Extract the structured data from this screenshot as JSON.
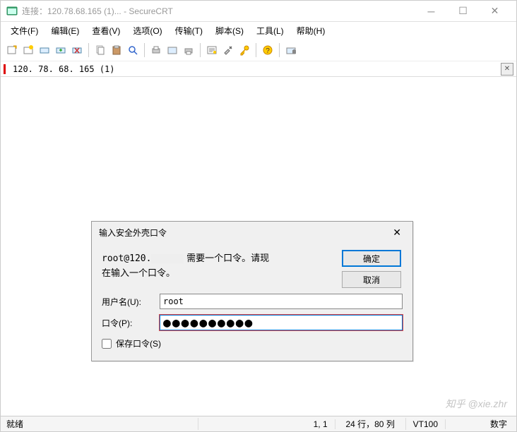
{
  "titlebar": {
    "text": "连接：120.78.68.165 (1)... - SecureCRT"
  },
  "menu": {
    "file": "文件(F)",
    "edit": "编辑(E)",
    "view": "查看(V)",
    "options": "选项(O)",
    "transfer": "传输(T)",
    "script": "脚本(S)",
    "tools": "工具(L)",
    "help": "帮助(H)"
  },
  "tab": {
    "label": "120. 78. 68. 165 (1)"
  },
  "dialog": {
    "title": "输入安全外壳口令",
    "msg_host_prefix": "root@120.",
    "msg_tail": " 需要一个口令。请现在输入一个口令。",
    "ok": "确定",
    "cancel": "取消",
    "user_label": "用户名(U):",
    "user_value": "root",
    "pwd_label": "口令(P):",
    "pwd_value": "●●●●●●●●●●",
    "save_label": "保存口令(S)"
  },
  "status": {
    "ready": "就绪",
    "pos": "1, 1",
    "size": "24 行，80 列",
    "term": "VT100",
    "num": "数字"
  },
  "watermark": "知乎 @xie.zhr"
}
